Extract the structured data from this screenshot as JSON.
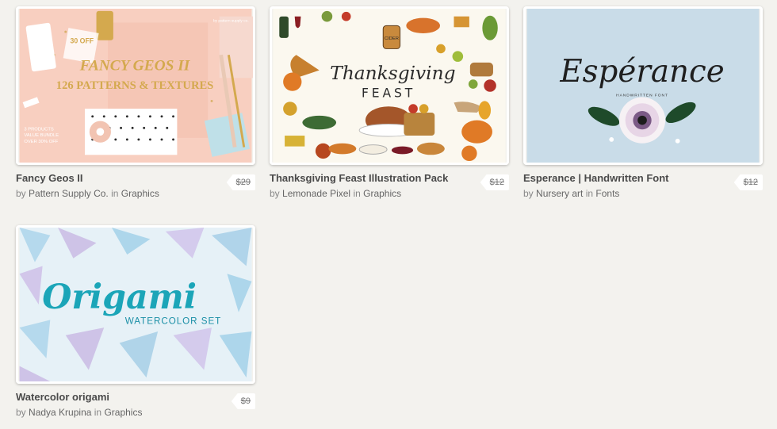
{
  "products": [
    {
      "title": "Fancy Geos II",
      "by_label": "by",
      "author": "Pattern Supply Co.",
      "in_label": "in",
      "category": "Graphics",
      "price": "$29",
      "thumb_text": {
        "headline": "FANCY GEOS II",
        "subhead": "126 PATTERNS & TEXTURES",
        "tag": "30 OFF",
        "badge": "by pattern supply co.",
        "bundle_line1": "3 PRODUCTS",
        "bundle_line2": "VALUE BUNDLE",
        "bundle_line3": "OVER 30% OFF"
      }
    },
    {
      "title": "Thanksgiving Feast Illustration Pack",
      "by_label": "by",
      "author": "Lemonade Pixel",
      "in_label": "in",
      "category": "Graphics",
      "price": "$12",
      "thumb_text": {
        "headline": "Thanksgiving",
        "subhead": "FEAST",
        "jar_label": "CIDER"
      }
    },
    {
      "title": "Esperance | Handwritten Font",
      "by_label": "by",
      "author": "Nursery art",
      "in_label": "in",
      "category": "Fonts",
      "price": "$12",
      "thumb_text": {
        "headline": "Espérance",
        "subhead": "HANDWRITTEN FONT"
      }
    },
    {
      "title": "Watercolor origami",
      "by_label": "by",
      "author": "Nadya Krupina",
      "in_label": "in",
      "category": "Graphics",
      "price": "$9",
      "thumb_text": {
        "headline": "Origami",
        "subhead": "WATERCOLOR SET"
      }
    }
  ],
  "colors": {
    "background": "#f3f2ee",
    "title": "#4a4a4a",
    "meta": "#888888",
    "card1_bg": "#f8cfc0",
    "card2_bg": "#fbf8ef",
    "card3_bg": "#c9dce8",
    "card4_bg": "#e6f1f7"
  }
}
